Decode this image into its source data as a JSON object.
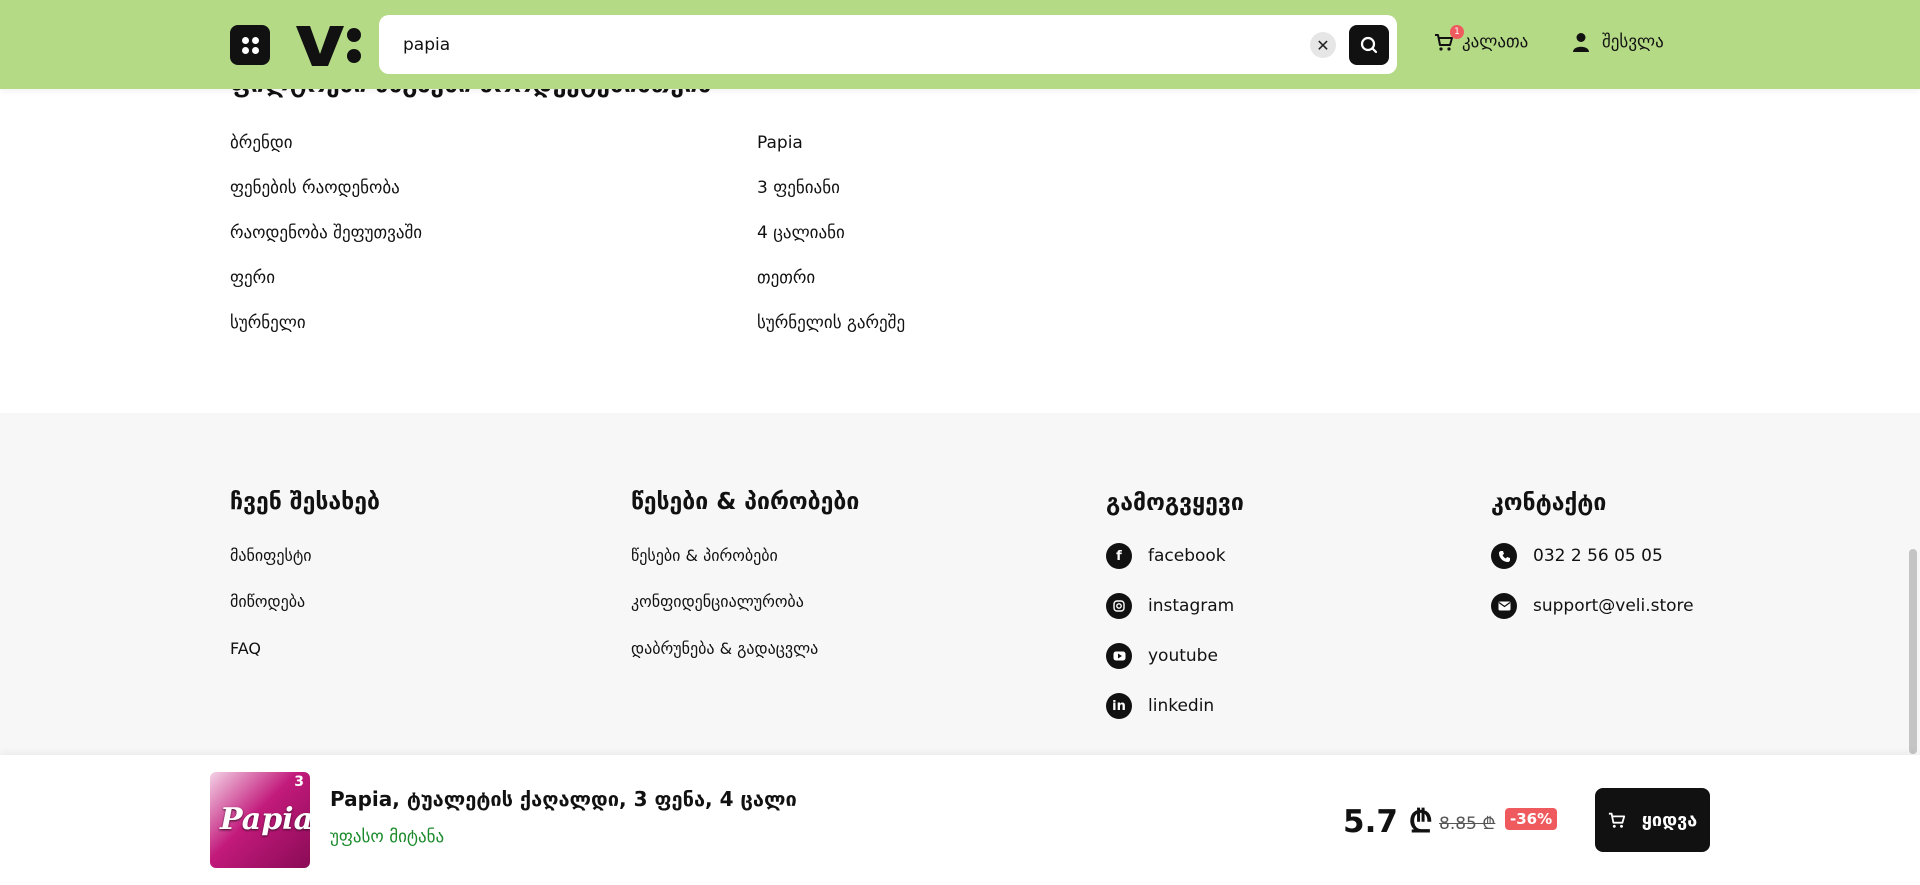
{
  "header": {
    "search_value": "papia",
    "cart_label": "კალათა",
    "cart_count": "1",
    "login_label": "შესვლა"
  },
  "specs": {
    "title": "ფილტრები მსგავსი პროდუქტებისთვის",
    "rows": [
      {
        "key": "ბრენდი",
        "value": "Papia"
      },
      {
        "key": "ფენების რაოდენობა",
        "value": "3 ფენიანი"
      },
      {
        "key": "რაოდენობა შეფუთვაში",
        "value": "4 ცალიანი"
      },
      {
        "key": "ფერი",
        "value": "თეთრი"
      },
      {
        "key": "სურნელი",
        "value": "სურნელის გარეშე"
      }
    ]
  },
  "footer": {
    "about": {
      "title": "ჩვენ შესახებ",
      "links": [
        "მანიფესტი",
        "მიწოდება",
        "FAQ"
      ]
    },
    "terms": {
      "title": "წესები & პირობები",
      "links": [
        "წესები & პირობები",
        "კონფიდენციალურობა",
        "დაბრუნება & გადაცვლა"
      ]
    },
    "follow": {
      "title": "გამოგვყევი",
      "links": [
        "facebook",
        "instagram",
        "youtube",
        "linkedin"
      ]
    },
    "contact": {
      "title": "კონტაქტი",
      "phone": "032 2 56 05 05",
      "email": "support@veli.store"
    }
  },
  "product": {
    "thumb_brand": "Papia",
    "thumb_count": "3",
    "title": "Papia, ტუალეტის ქაღალდი, 3 ფენა, 4 ცალი",
    "shipping": "უფასო მიტანა",
    "price": "5.7 ₾",
    "old_price": "8.85 ₾",
    "discount": "-36%",
    "buy_label": "ყიდვა"
  }
}
